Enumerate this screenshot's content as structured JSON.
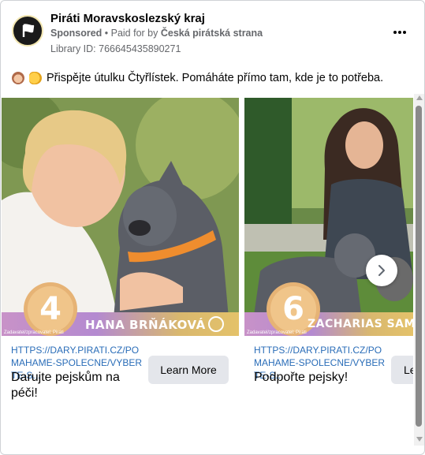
{
  "post": {
    "page_name": "Piráti Moravskoslezský kraj",
    "sponsored": "Sponsored",
    "paid_for_prefix": " • Paid for by ",
    "payer": "Česká pirátská strana",
    "library_id": "Library ID: 766645435890271",
    "primary_text": "Přispějte útulku Čtyřlístek. Pomáháte přímo tam, kde je to potřeba."
  },
  "cards": [
    {
      "number": "4",
      "name": "HANA BRŇÁKOVÁ",
      "banner_small": "Zadavatel/zpracovatel: Piráti",
      "url": "HTTPS://DARY.PIRATI.CZ/POMAHAME-SPOLECNE/VYBERTE-S...",
      "headline": "Darujte pejskům na péči!",
      "cta": "Learn More"
    },
    {
      "number": "6",
      "name": "ZACHARIAS SAMUEL FISC",
      "banner_small": "Zadavatel/zpracovatel: Piráti",
      "url": "HTTPS://DARY.PIRATI.CZ/POMAHAME-SPOLECNE/VYBERTE-S...",
      "headline": "Podpořte pejsky!",
      "cta": "Le"
    }
  ],
  "icons": {
    "more": "more-horizontal-icon",
    "next": "chevron-right-icon",
    "logo": "pirate-flag-icon"
  },
  "colors": {
    "link": "#2a6db8",
    "button_bg": "#e4e6eb",
    "banner_gradient_start": "#c892c8",
    "banner_gradient_end": "#e4c26a"
  }
}
